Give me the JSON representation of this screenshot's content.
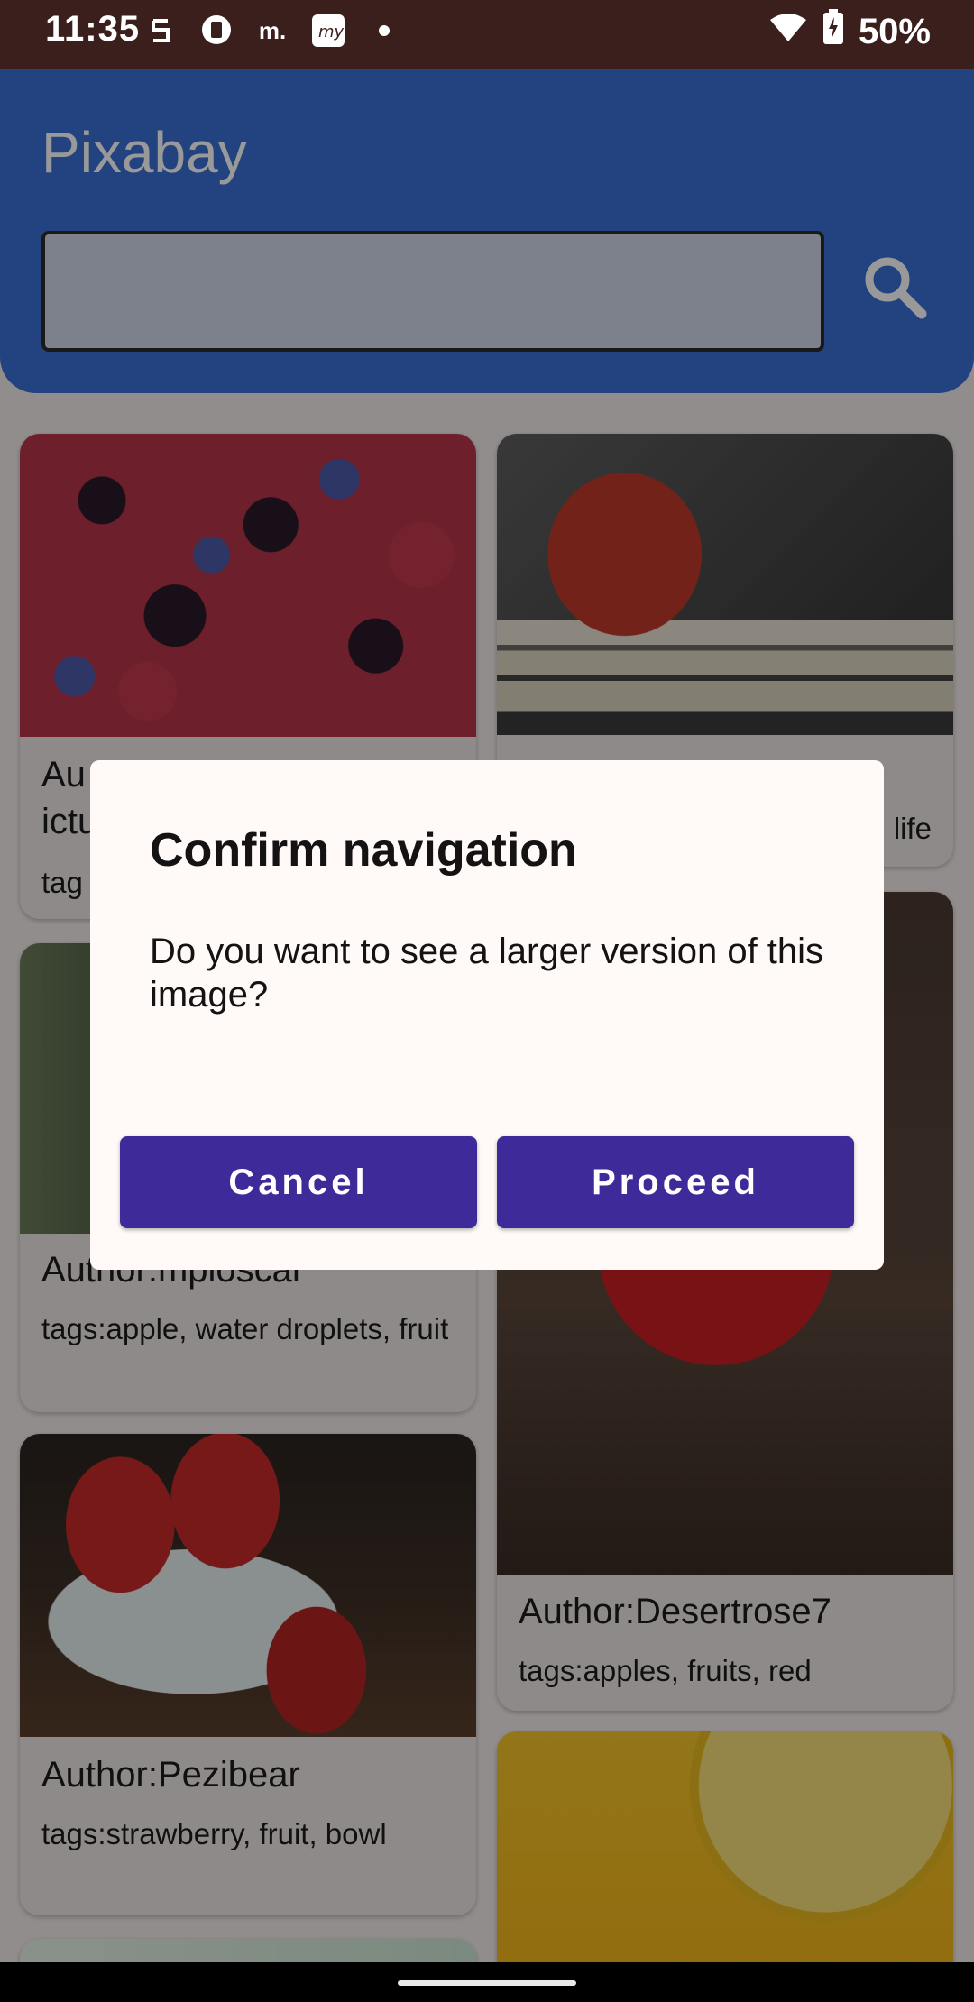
{
  "status_bar": {
    "time": "11:35",
    "battery": "50%",
    "notification_icons": [
      "sync-icon",
      "message-icon",
      "m-icon",
      "myntra-icon",
      "dot-icon"
    ],
    "status_icons": [
      "wifi-icon",
      "battery-icon"
    ]
  },
  "app_bar": {
    "title": "Pixabay",
    "search": {
      "value": "",
      "placeholder": ""
    },
    "search_icon": "search-icon"
  },
  "cards": [
    {
      "author": "Au",
      "tags": "tag",
      "author_line2": "ictu"
    },
    {
      "author": "",
      "tags": "life"
    },
    {
      "author": "Author:mploscar",
      "tags": "tags:apple, water droplets, fruit"
    },
    {
      "author": "Author:Desertrose7",
      "tags": "tags:apples, fruits, red"
    },
    {
      "author": "Author:Pezibear",
      "tags": "tags:strawberry, fruit, bowl"
    }
  ],
  "dialog": {
    "title": "Confirm navigation",
    "message": "Do you want to see a larger version of this image?",
    "cancel_label": "Cancel",
    "proceed_label": "Proceed"
  },
  "colors": {
    "app_bar": "#3a6fd6",
    "dialog_button": "#3f2a9a",
    "status_bar": "#3b1f1c"
  }
}
